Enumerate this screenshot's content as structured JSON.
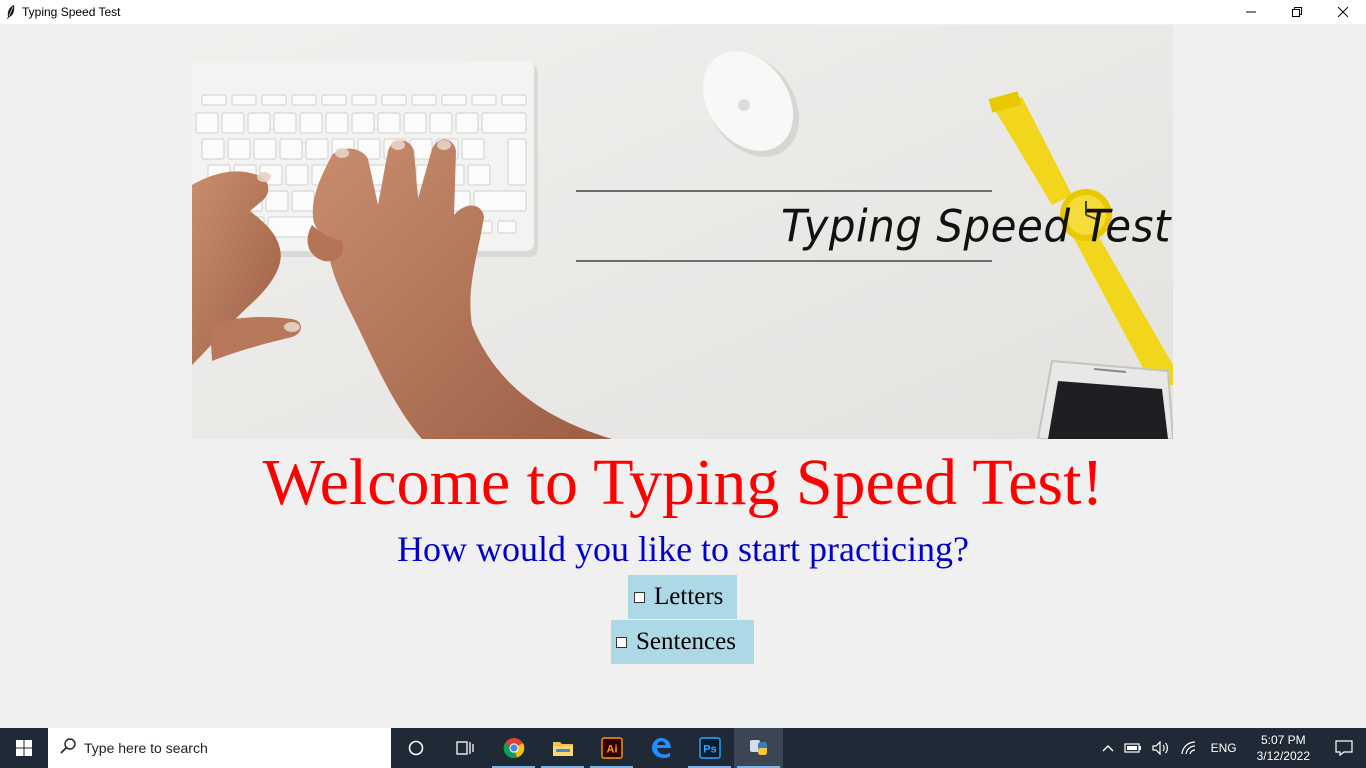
{
  "window": {
    "title": "Typing Speed Test",
    "controls": [
      "minimize-icon",
      "restore-icon",
      "close-icon"
    ]
  },
  "banner": {
    "title": "Typing Speed Test"
  },
  "main": {
    "welcome": "Welcome to Typing Speed Test!",
    "question": "How would you like to start practicing?",
    "options": [
      {
        "label": "Letters",
        "checked": false
      },
      {
        "label": "Sentences",
        "checked": false
      }
    ]
  },
  "colors": {
    "welcome": "#ff0000",
    "question": "#0000cc",
    "option_bg": "#add8e6",
    "window_bg": "#f0f0f0",
    "taskbar_bg": "#1f2a36"
  },
  "taskbar": {
    "search_placeholder": "Type here to search",
    "apps": [
      "cortana-icon",
      "task-view-icon",
      "chrome-icon",
      "file-explorer-icon",
      "illustrator-icon",
      "edge-icon",
      "photoshop-icon",
      "python-icon"
    ],
    "illustrator_label": "Ai",
    "photoshop_label": "Ps",
    "language": "ENG",
    "time": "5:07 PM",
    "date": "3/12/2022"
  }
}
